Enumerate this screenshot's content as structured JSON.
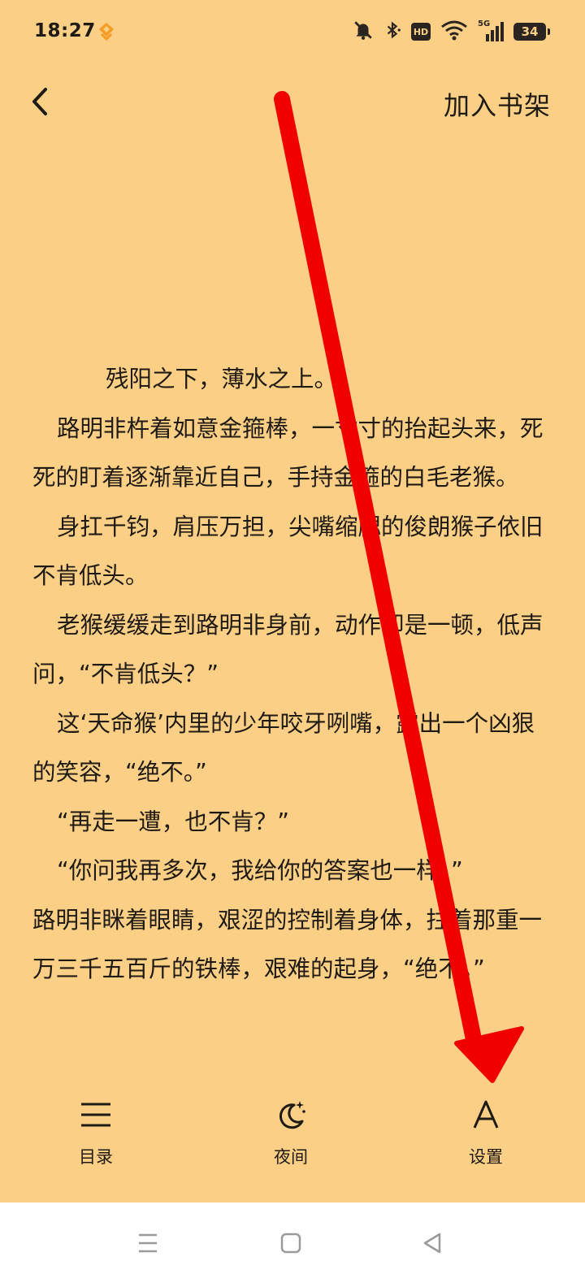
{
  "status_bar": {
    "time": "18:27",
    "network": "5G",
    "hd": "HD",
    "battery": "34"
  },
  "header": {
    "add_to_shelf": "加入书架"
  },
  "reader": {
    "paragraphs": [
      "残阳之下，薄水之上。",
      "路明非杵着如意金箍棒，一寸寸的抬起头来，死死的盯着逐渐靠近自己，手持金箍的白毛老猴。",
      "身扛千钧，肩压万担，尖嘴缩腮的俊朗猴子依旧不肯低头。",
      "老猴缓缓走到路明非身前，动作却是一顿，低声问，“不肯低头？”",
      "这‘天命猴’内里的少年咬牙咧嘴，露出一个凶狠的笑容，“绝不。”",
      "“再走一遭，也不肯？”",
      "“你问我再多次，我给你的答案也一样。”",
      "路明非眯着眼睛，艰涩的控制着身体，拄着那重一万三千五百斤的铁棒，艰难的起身，“绝不。”"
    ]
  },
  "toolbar": {
    "catalog_label": "目录",
    "night_label": "夜间",
    "settings_label": "设置"
  },
  "colors": {
    "background": "#fccf86",
    "text": "#1e1a14",
    "annotation_arrow": "#f00000"
  }
}
